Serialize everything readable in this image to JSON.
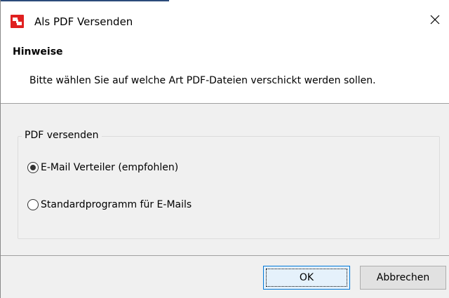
{
  "window": {
    "title": "Als PDF Versenden",
    "icon": "pdf-app-icon",
    "close_icon": "close-icon"
  },
  "hint": {
    "title": "Hinweise",
    "text": "Bitte wählen Sie auf welche Art PDF-Dateien verschickt werden sollen."
  },
  "group": {
    "legend": "PDF versenden",
    "options": [
      {
        "label": "E-Mail Verteiler (empfohlen)",
        "selected": true
      },
      {
        "label": "Standardprogramm für E-Mails",
        "selected": false
      }
    ]
  },
  "buttons": {
    "ok_label": "OK",
    "cancel_label": "Abbrechen"
  },
  "colors": {
    "icon_red": "#e02020",
    "dialog_background": "#f0f0f0",
    "default_button_border": "#0078d7"
  }
}
